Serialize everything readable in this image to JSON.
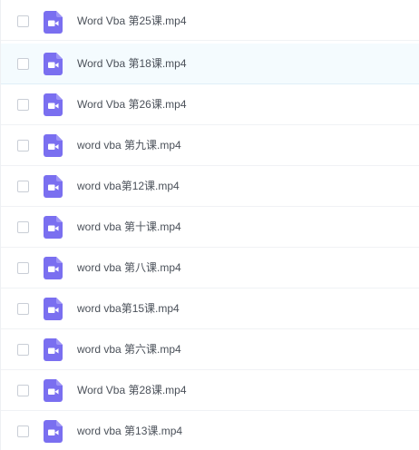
{
  "colors": {
    "icon_fill": "#7a6ff0",
    "icon_glyph": "#ffffff",
    "hover_row_bg": "#f4fbfe",
    "text": "#4a5059"
  },
  "file_list": {
    "hovered_index": 1,
    "items": [
      {
        "name": "Word Vba 第25课.mp4",
        "icon": "video-file-icon",
        "checked": false
      },
      {
        "name": "Word Vba 第18课.mp4",
        "icon": "video-file-icon",
        "checked": false
      },
      {
        "name": "Word Vba 第26课.mp4",
        "icon": "video-file-icon",
        "checked": false
      },
      {
        "name": "word vba 第九课.mp4",
        "icon": "video-file-icon",
        "checked": false
      },
      {
        "name": "word vba第12课.mp4",
        "icon": "video-file-icon",
        "checked": false
      },
      {
        "name": "word vba 第十课.mp4",
        "icon": "video-file-icon",
        "checked": false
      },
      {
        "name": "word vba 第八课.mp4",
        "icon": "video-file-icon",
        "checked": false
      },
      {
        "name": "word vba第15课.mp4",
        "icon": "video-file-icon",
        "checked": false
      },
      {
        "name": "word vba 第六课.mp4",
        "icon": "video-file-icon",
        "checked": false
      },
      {
        "name": "Word Vba 第28课.mp4",
        "icon": "video-file-icon",
        "checked": false
      },
      {
        "name": "word vba 第13课.mp4",
        "icon": "video-file-icon",
        "checked": false
      }
    ]
  }
}
